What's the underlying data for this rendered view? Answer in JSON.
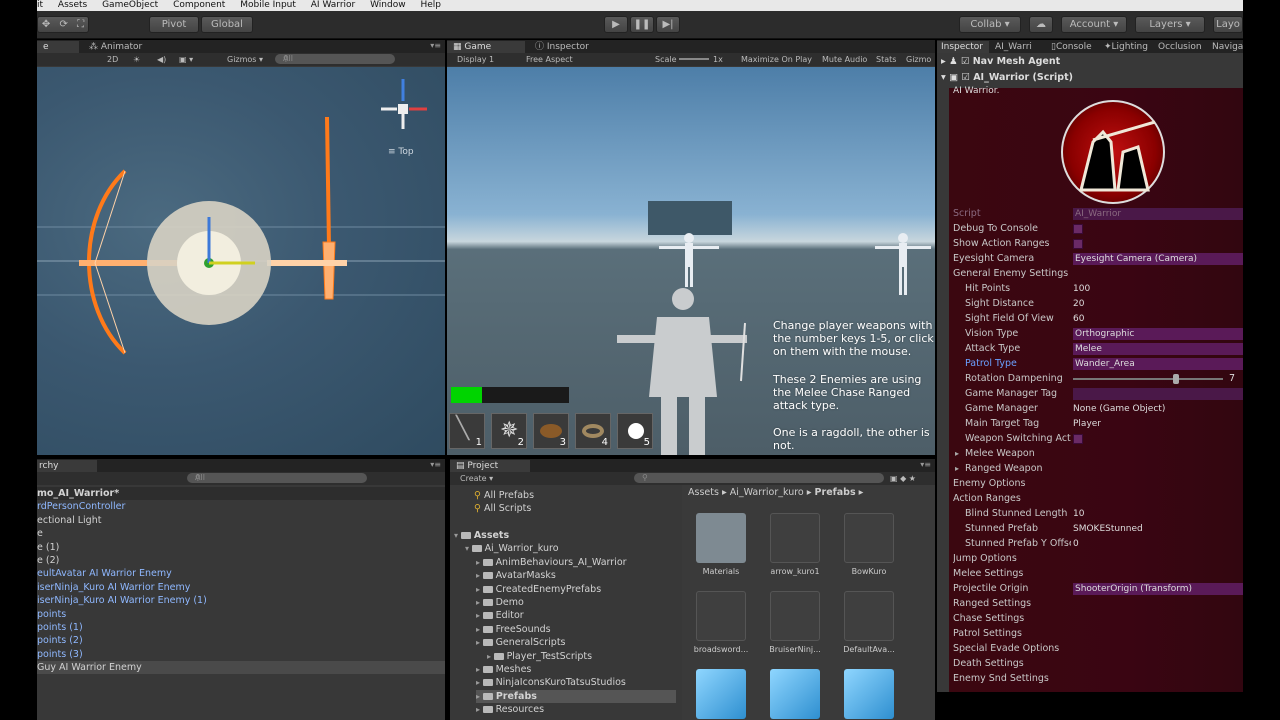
{
  "menu": [
    "it",
    "Assets",
    "GameObject",
    "Component",
    "Mobile Input",
    "AI Warrior",
    "Window",
    "Help"
  ],
  "toolbar": {
    "pivot": "Pivot",
    "global": "Global",
    "collab": "Collab ▾",
    "account": "Account",
    "layers": "Layers",
    "layout": "Layo"
  },
  "scene": {
    "tab_scene": "e",
    "tab_animator": "Animator",
    "mode_2d": "2D",
    "gizmos": "Gizmos ▾",
    "search_all": "All",
    "view_label": "Top"
  },
  "game": {
    "tab_game": "Game",
    "tab_inspector": "Inspector",
    "display": "Display 1",
    "aspect": "Free Aspect",
    "scale_label": "Scale",
    "scale_value": "1x",
    "maximize": "Maximize On Play",
    "mute": "Mute Audio",
    "stats": "Stats",
    "gizmos": "Gizmo",
    "text1": "Change player weapons with the number keys 1-5, or click on them with the mouse.",
    "text2": "These 2 Enemies are using the Melee Chase Ranged attack type.",
    "text3": "One is a ragdoll, the other is not.",
    "slots": [
      "1",
      "2",
      "3",
      "4",
      "5"
    ],
    "health_fraction": 0.26
  },
  "inspector": {
    "tabs": [
      "Inspector",
      "AI_Warri",
      "Console",
      "Lighting",
      "Occlusion",
      "Naviga"
    ],
    "component1": "Nav Mesh Agent",
    "component2": "AI_Warrior (Script)",
    "header": "AI Warrior.",
    "props": [
      {
        "label": "Script",
        "value": "AI_Warrior",
        "indent": 0,
        "kind": "field",
        "dim": true
      },
      {
        "label": "Debug To Console",
        "value": "",
        "indent": 0,
        "kind": "check"
      },
      {
        "label": "Show Action Ranges",
        "value": "",
        "indent": 0,
        "kind": "check"
      },
      {
        "label": "Eyesight Camera",
        "value": "Eyesight Camera (Camera)",
        "indent": 0,
        "kind": "purple"
      },
      {
        "label": "General Enemy Settings",
        "value": "",
        "indent": 0,
        "kind": "fold"
      },
      {
        "label": "Hit Points",
        "value": "100",
        "indent": 1,
        "kind": "text"
      },
      {
        "label": "Sight Distance",
        "value": "20",
        "indent": 1,
        "kind": "text"
      },
      {
        "label": "Sight Field Of View",
        "value": "60",
        "indent": 1,
        "kind": "text"
      },
      {
        "label": "Vision Type",
        "value": "Orthographic",
        "indent": 1,
        "kind": "purple"
      },
      {
        "label": "Attack Type",
        "value": "Melee",
        "indent": 1,
        "kind": "purple"
      },
      {
        "label": "Patrol Type",
        "value": "Wander_Area",
        "indent": 1,
        "kind": "purple",
        "blue": true
      },
      {
        "label": "Rotation Dampening",
        "value": "7",
        "indent": 1,
        "kind": "slider"
      },
      {
        "label": "Game Manager Tag",
        "value": "",
        "indent": 1,
        "kind": "field"
      },
      {
        "label": "Game Manager",
        "value": "None (Game Object)",
        "indent": 1,
        "kind": "text"
      },
      {
        "label": "Main Target Tag",
        "value": "Player",
        "indent": 1,
        "kind": "text"
      },
      {
        "label": "Weapon Switching Acti",
        "value": "",
        "indent": 1,
        "kind": "check"
      },
      {
        "label": "Melee Weapon",
        "value": "",
        "indent": 1,
        "kind": "fold"
      },
      {
        "label": "Ranged Weapon",
        "value": "",
        "indent": 1,
        "kind": "fold"
      },
      {
        "label": "Enemy Options",
        "value": "",
        "indent": 0,
        "kind": "fold"
      },
      {
        "label": "Action Ranges",
        "value": "",
        "indent": 0,
        "kind": "fold"
      },
      {
        "label": "Blind Stunned Length",
        "value": "10",
        "indent": 1,
        "kind": "text"
      },
      {
        "label": "Stunned Prefab",
        "value": "SMOKEStunned",
        "indent": 1,
        "kind": "text"
      },
      {
        "label": "Stunned Prefab Y Offse",
        "value": "0",
        "indent": 1,
        "kind": "text"
      },
      {
        "label": "Jump Options",
        "value": "",
        "indent": 0,
        "kind": "fold"
      },
      {
        "label": "Melee Settings",
        "value": "",
        "indent": 0,
        "kind": "fold"
      },
      {
        "label": "Projectile Origin",
        "value": "ShooterOrigin (Transform)",
        "indent": 0,
        "kind": "purple"
      },
      {
        "label": "Ranged Settings",
        "value": "",
        "indent": 0,
        "kind": "fold"
      },
      {
        "label": "Chase Settings",
        "value": "",
        "indent": 0,
        "kind": "fold"
      },
      {
        "label": "Patrol Settings",
        "value": "",
        "indent": 0,
        "kind": "fold"
      },
      {
        "label": "Special Evade Options",
        "value": "",
        "indent": 0,
        "kind": "fold"
      },
      {
        "label": "Death Settings",
        "value": "",
        "indent": 0,
        "kind": "fold"
      },
      {
        "label": "Enemy Snd Settings",
        "value": "",
        "indent": 0,
        "kind": "fold"
      }
    ]
  },
  "hierarchy": {
    "tab": "rchy",
    "search": "All",
    "items": [
      {
        "text": "mo_AI_Warrior*",
        "color": "white"
      },
      {
        "text": "rdPersonController",
        "color": "blue"
      },
      {
        "text": "ectional Light",
        "color": "white"
      },
      {
        "text": "e",
        "color": "white"
      },
      {
        "text": "e (1)",
        "color": "white"
      },
      {
        "text": "e (2)",
        "color": "white"
      },
      {
        "text": "eultAvatar AI Warrior Enemy",
        "color": "blue"
      },
      {
        "text": "iserNinja_Kuro AI Warrior Enemy",
        "color": "blue"
      },
      {
        "text": "iserNinja_Kuro AI Warrior Enemy (1)",
        "color": "blue"
      },
      {
        "text": "points",
        "color": "blue"
      },
      {
        "text": "points (1)",
        "color": "blue"
      },
      {
        "text": "points (2)",
        "color": "blue"
      },
      {
        "text": "points (3)",
        "color": "blue"
      },
      {
        "text": "Guy AI Warrior Enemy",
        "color": "white"
      }
    ]
  },
  "project": {
    "tab": "Project",
    "create": "Create ▾",
    "favorites": [
      "All Prefabs",
      "All Scripts"
    ],
    "tree": [
      {
        "text": "Assets",
        "indent": 0,
        "bold": true
      },
      {
        "text": "Ai_Warrior_kuro",
        "indent": 1
      },
      {
        "text": "AnimBehaviours_AI_Warrior",
        "indent": 2
      },
      {
        "text": "AvatarMasks",
        "indent": 2
      },
      {
        "text": "CreatedEnemyPrefabs",
        "indent": 2
      },
      {
        "text": "Demo",
        "indent": 2
      },
      {
        "text": "Editor",
        "indent": 2
      },
      {
        "text": "FreeSounds",
        "indent": 2
      },
      {
        "text": "GeneralScripts",
        "indent": 2
      },
      {
        "text": "Player_TestScripts",
        "indent": 3
      },
      {
        "text": "Meshes",
        "indent": 2
      },
      {
        "text": "NinjaIconsKuroTatsuStudios",
        "indent": 2
      },
      {
        "text": "Prefabs",
        "indent": 2,
        "bold": true
      },
      {
        "text": "Resources",
        "indent": 2
      }
    ],
    "breadcrumb": {
      "a": "Assets",
      "b": "Ai_Warrior_kuro",
      "c": "Prefabs"
    },
    "assets": [
      "Materials",
      "arrow_kuro1",
      "BowKuro",
      "broadsword...",
      "BruiserNinj...",
      "DefaultAva...",
      "",
      "",
      ""
    ]
  }
}
